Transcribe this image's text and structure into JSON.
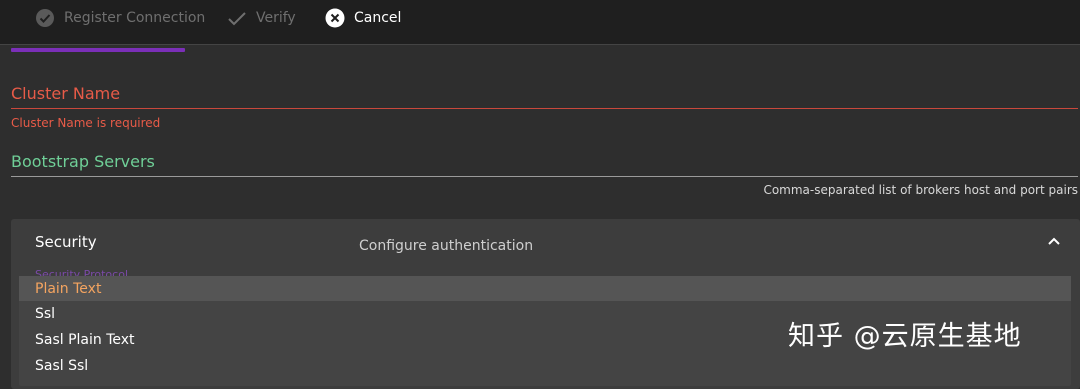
{
  "steps": [
    {
      "label": "Register Connection",
      "icon": "check-circle-icon",
      "state": "done"
    },
    {
      "label": "Verify",
      "icon": "check-icon",
      "state": "pending"
    },
    {
      "label": "Cancel",
      "icon": "close-circle-icon",
      "state": "action"
    }
  ],
  "form": {
    "cluster_name": {
      "label": "Cluster Name",
      "error": "Cluster Name is required"
    },
    "bootstrap_servers": {
      "label": "Bootstrap Servers",
      "hint": "Comma-separated list of brokers host and port pairs"
    }
  },
  "security": {
    "title": "Security",
    "description": "Configure authentication",
    "protocol_label": "Security Protocol",
    "options": [
      "Plain Text",
      "Ssl",
      "Sasl Plain Text",
      "Sasl Ssl"
    ],
    "selected": "Plain Text"
  },
  "watermark": "知乎 @云原生基地",
  "colors": {
    "accent": "#7b2fb8",
    "error": "#e85b48",
    "success": "#6fcf97",
    "selected_option": "#f4a460"
  }
}
